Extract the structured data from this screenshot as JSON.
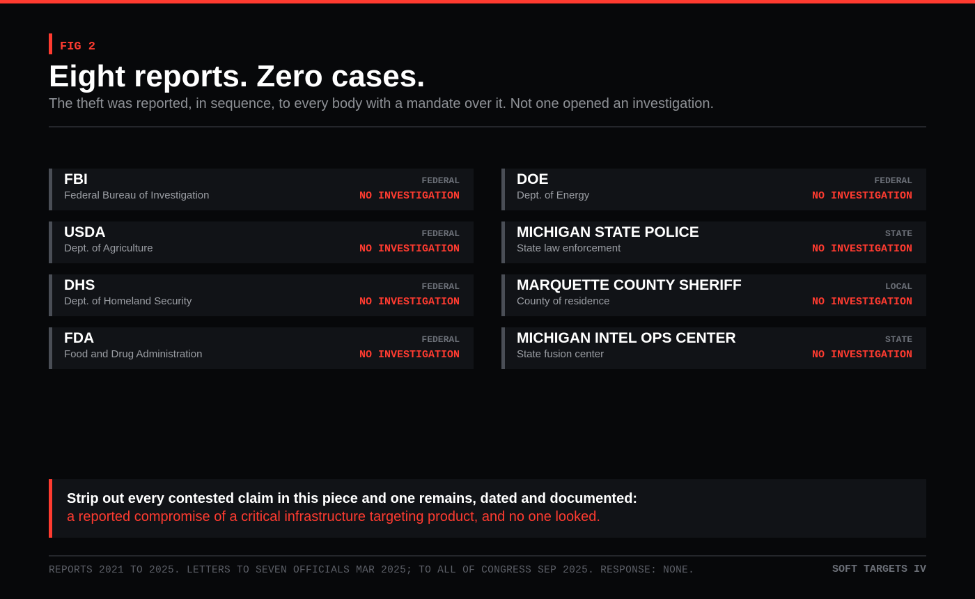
{
  "colors": {
    "accent": "#ff3b30",
    "background": "#07080a",
    "card": "#111317",
    "card_border": "#4a4e56",
    "muted_text": "#8e9196"
  },
  "header": {
    "fig_label": "FIG 2",
    "title": "Eight reports. Zero cases.",
    "subtitle": "The theft was reported, in sequence, to every body with a mandate over it. Not one opened an investigation."
  },
  "agencies": {
    "left": [
      {
        "name": "FBI",
        "desc": "Federal Bureau of Investigation",
        "level": "FEDERAL",
        "status": "NO INVESTIGATION"
      },
      {
        "name": "USDA",
        "desc": "Dept. of Agriculture",
        "level": "FEDERAL",
        "status": "NO INVESTIGATION"
      },
      {
        "name": "DHS",
        "desc": "Dept. of Homeland Security",
        "level": "FEDERAL",
        "status": "NO INVESTIGATION"
      },
      {
        "name": "FDA",
        "desc": "Food and Drug Administration",
        "level": "FEDERAL",
        "status": "NO INVESTIGATION"
      }
    ],
    "right": [
      {
        "name": "DOE",
        "desc": "Dept. of Energy",
        "level": "FEDERAL",
        "status": "NO INVESTIGATION"
      },
      {
        "name": "MICHIGAN STATE POLICE",
        "desc": "State law enforcement",
        "level": "STATE",
        "status": "NO INVESTIGATION"
      },
      {
        "name": "MARQUETTE COUNTY SHERIFF",
        "desc": "County of residence",
        "level": "LOCAL",
        "status": "NO INVESTIGATION"
      },
      {
        "name": "MICHIGAN INTEL OPS CENTER",
        "desc": "State fusion center",
        "level": "STATE",
        "status": "NO INVESTIGATION"
      }
    ]
  },
  "callout": {
    "line1": "Strip out every contested claim in this piece and one remains, dated and documented:",
    "line2": "a reported compromise of a critical infrastructure targeting product, and no one looked."
  },
  "footer": {
    "note": "REPORTS 2021 TO 2025. LETTERS TO SEVEN OFFICIALS MAR 2025; TO ALL OF CONGRESS SEP 2025. RESPONSE: NONE.",
    "brand": "SOFT TARGETS IV"
  }
}
